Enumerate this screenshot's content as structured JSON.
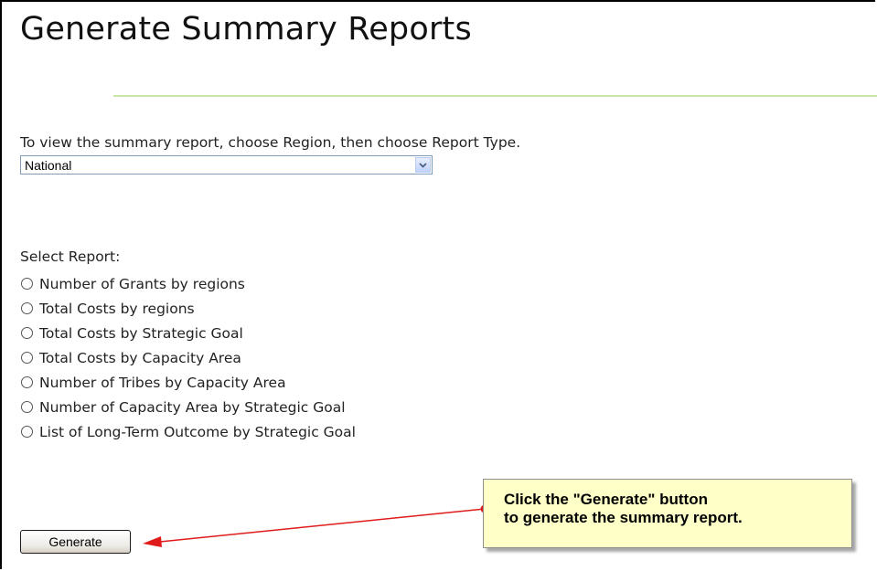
{
  "page": {
    "title": "Generate Summary Reports",
    "instruction": "To view the summary report, choose Region, then choose Report Type."
  },
  "region_select": {
    "selected": "National"
  },
  "report_select": {
    "label": "Select Report:",
    "options": [
      "Number of Grants by regions",
      "Total Costs by regions",
      "Total Costs by Strategic Goal",
      "Total Costs by Capacity Area",
      "Number of Tribes by Capacity Area",
      "Number of Capacity Area by Strategic Goal",
      "List of Long-Term Outcome by Strategic Goal"
    ]
  },
  "actions": {
    "generate_label": "Generate"
  },
  "callout": {
    "line1": "Click the \"Generate\" button",
    "line2": "to generate the summary report.",
    "arrow_color": "#e01b1b",
    "background": "#ffffc8"
  }
}
